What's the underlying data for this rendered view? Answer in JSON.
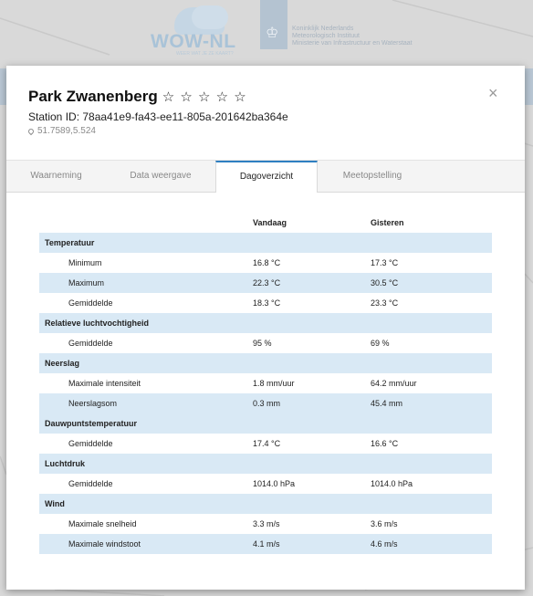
{
  "brand": {
    "wow_logo_text": "WOW-NL",
    "wow_tagline": "WEER WAT JE ZE KAART?",
    "knmi_lines": "Koninklijk Nederlands\nMeteorologisch Instituut\nMinisterie van Infrastructuur en Waterstaat"
  },
  "station": {
    "name": "Park Zwanenberg",
    "rating_stars": [
      "☆",
      "☆",
      "☆",
      "☆",
      "☆"
    ],
    "id_text": "Station ID: 78aa41e9-fa43-ee11-805a-201642ba364e",
    "coords": "51.7589,5.524",
    "close_glyph": "×"
  },
  "tabs": [
    {
      "label": "Waarneming"
    },
    {
      "label": "Data weergave"
    },
    {
      "label": "Dagoverzicht",
      "active": true
    },
    {
      "label": "Meetopstelling"
    }
  ],
  "table": {
    "col_today": "Vandaag",
    "col_yesterday": "Gisteren",
    "rows": [
      {
        "type": "group",
        "label": "Temperatuur"
      },
      {
        "type": "item",
        "label": "Minimum",
        "today": "16.8 °C",
        "yesterday": "17.3 °C"
      },
      {
        "type": "item",
        "label": "Maximum",
        "today": "22.3 °C",
        "yesterday": "30.5 °C"
      },
      {
        "type": "item",
        "label": "Gemiddelde",
        "today": "18.3 °C",
        "yesterday": "23.3 °C"
      },
      {
        "type": "group",
        "label": "Relatieve luchtvochtigheid"
      },
      {
        "type": "item",
        "label": "Gemiddelde",
        "today": "95 %",
        "yesterday": "69 %"
      },
      {
        "type": "group",
        "label": "Neerslag"
      },
      {
        "type": "item",
        "label": "Maximale intensiteit",
        "today": "1.8 mm/uur",
        "yesterday": "64.2 mm/uur"
      },
      {
        "type": "item",
        "label": "Neerslagsom",
        "today": "0.3 mm",
        "yesterday": "45.4 mm"
      },
      {
        "type": "group",
        "label": "Dauwpuntstemperatuur"
      },
      {
        "type": "item",
        "label": "Gemiddelde",
        "today": "17.4 °C",
        "yesterday": "16.6 °C"
      },
      {
        "type": "group",
        "label": "Luchtdruk"
      },
      {
        "type": "item",
        "label": "Gemiddelde",
        "today": "1014.0 hPa",
        "yesterday": "1014.0 hPa"
      },
      {
        "type": "group",
        "label": "Wind"
      },
      {
        "type": "item",
        "label": "Maximale snelheid",
        "today": "3.3 m/s",
        "yesterday": "3.6 m/s"
      },
      {
        "type": "item",
        "label": "Maximale windstoot",
        "today": "4.1 m/s",
        "yesterday": "4.6 m/s"
      }
    ]
  }
}
